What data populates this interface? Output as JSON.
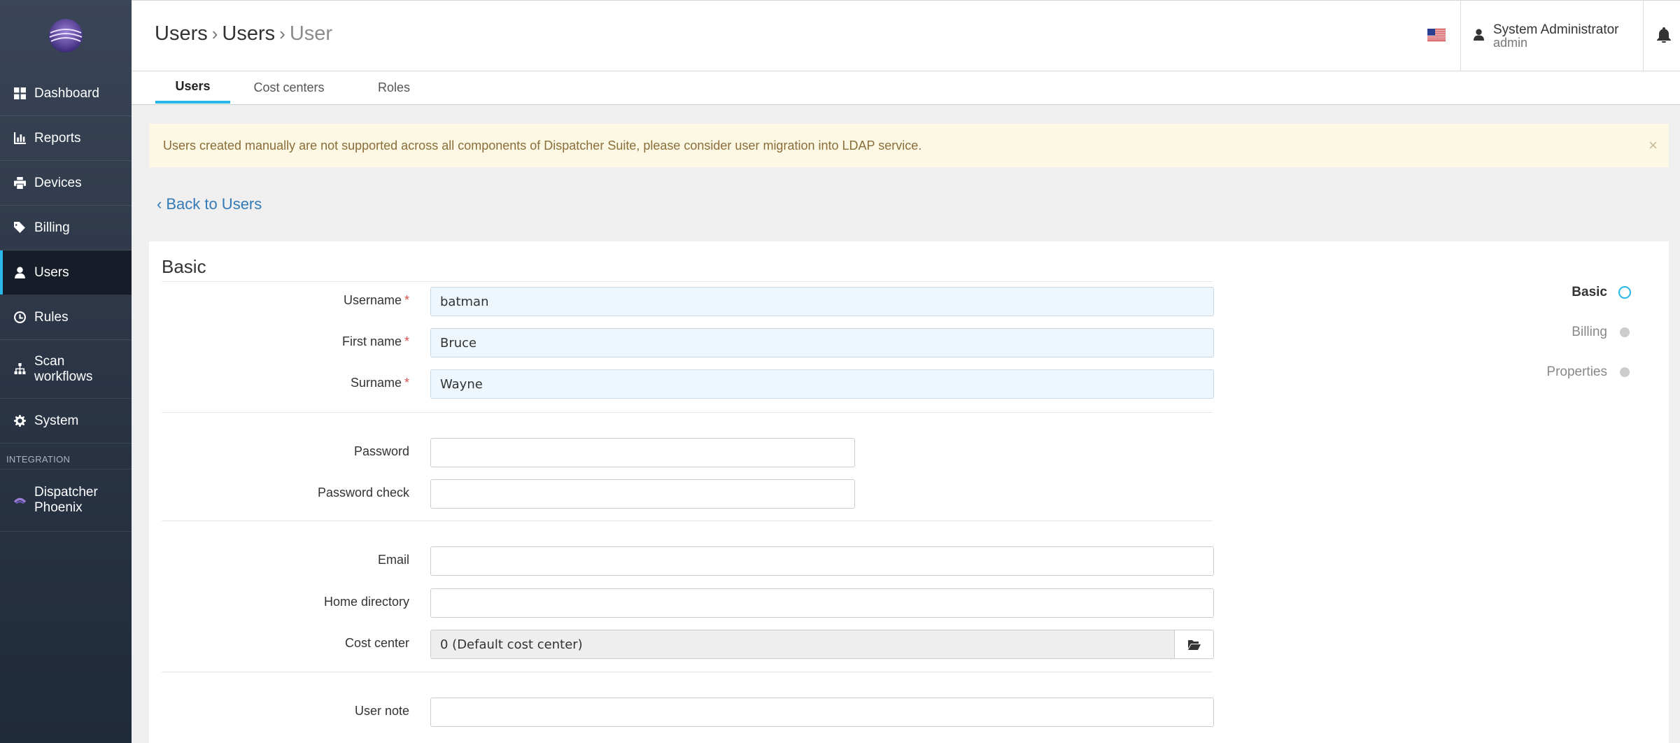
{
  "sidebar": {
    "items": [
      {
        "label": "Dashboard",
        "icon": "dashboard-icon"
      },
      {
        "label": "Reports",
        "icon": "bar-chart-icon"
      },
      {
        "label": "Devices",
        "icon": "printer-icon"
      },
      {
        "label": "Billing",
        "icon": "tags-icon"
      },
      {
        "label": "Users",
        "icon": "user-icon"
      },
      {
        "label": "Rules",
        "icon": "clock-icon"
      },
      {
        "label": "Scan",
        "label2": "workflows",
        "icon": "sitemap-icon"
      },
      {
        "label": "System",
        "icon": "gear-icon"
      }
    ],
    "section_label": "INTEGRATION",
    "integration": {
      "label": "Dispatcher",
      "label2": "Phoenix",
      "icon": "phoenix-logo-icon"
    },
    "accent": "#29b6e8"
  },
  "header": {
    "breadcrumb": [
      "Users",
      "Users",
      "User"
    ],
    "language": "en-us-flag-icon",
    "user_name": "System Administrator",
    "user_login": "admin"
  },
  "tabs": [
    "Users",
    "Cost centers",
    "Roles"
  ],
  "alert": {
    "text": "Users created manually are not supported across all components of Dispatcher Suite, please consider user migration into LDAP service.",
    "close": "×"
  },
  "back_link": "Back to Users",
  "form": {
    "section_title": "Basic",
    "username": {
      "label": "Username",
      "value": "batman"
    },
    "first_name": {
      "label": "First name",
      "value": "Bruce"
    },
    "surname": {
      "label": "Surname",
      "value": "Wayne"
    },
    "password": {
      "label": "Password",
      "value": ""
    },
    "password_check": {
      "label": "Password check",
      "value": ""
    },
    "email": {
      "label": "Email",
      "value": ""
    },
    "home_directory": {
      "label": "Home directory",
      "value": ""
    },
    "cost_center": {
      "label": "Cost center",
      "value": "0 (Default cost center)"
    },
    "user_note": {
      "label": "User note",
      "value": ""
    },
    "required_mark": "*"
  },
  "steps": [
    "Basic",
    "Billing",
    "Properties"
  ]
}
